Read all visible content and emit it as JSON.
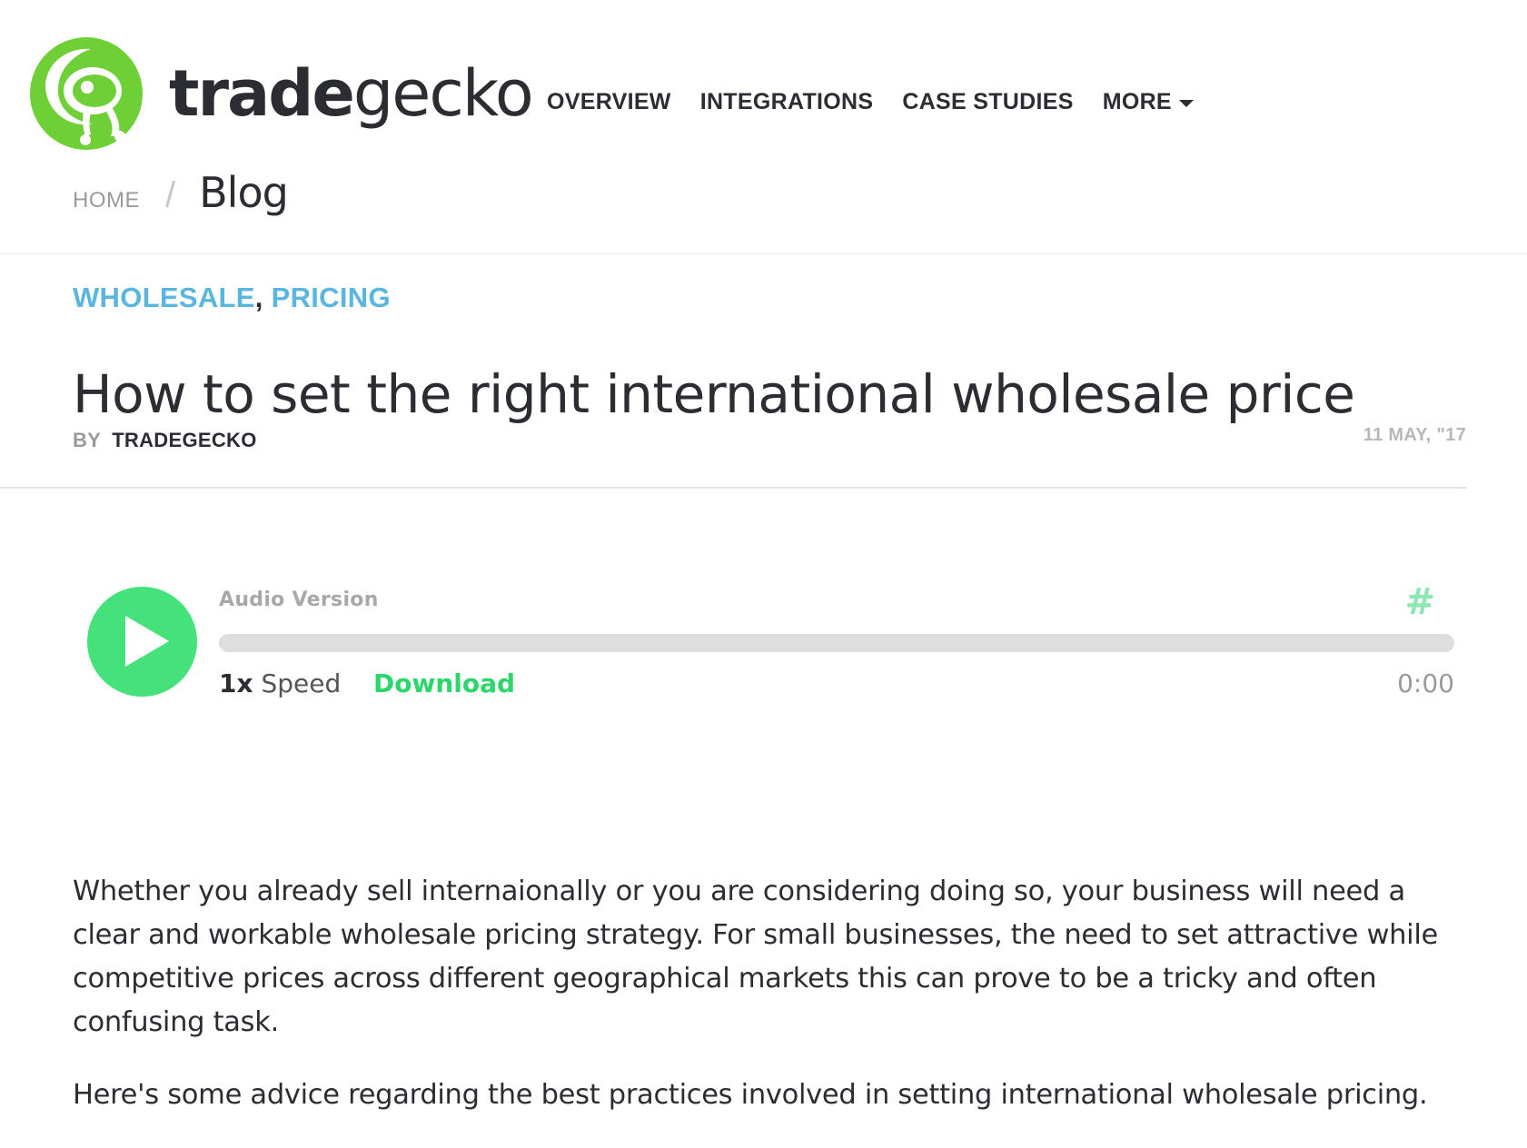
{
  "brand": {
    "name_bold": "trade",
    "name_light": "gecko",
    "logo_icon": "gecko-logo-icon",
    "accent": "#6fcf37"
  },
  "nav": {
    "items": [
      {
        "label": "OVERVIEW"
      },
      {
        "label": "INTEGRATIONS"
      },
      {
        "label": "CASE STUDIES"
      },
      {
        "label": "MORE"
      }
    ]
  },
  "breadcrumb": {
    "home": "HOME",
    "separator": "/",
    "current": "Blog"
  },
  "article": {
    "categories": [
      "WHOLESALE",
      "PRICING"
    ],
    "category_separator": ",",
    "category_color": "#5ab6de",
    "title": "How to set the right international wholesale price",
    "by_label": "BY",
    "author": "TRADEGECKO",
    "date": "11 MAY, \"17",
    "paragraphs": [
      "Whether you already sell internaionally or you are considering doing so, your business will need a clear and workable wholesale pricing strategy. For small businesses, the need to set attractive while competitive prices across different geographical markets this can prove to be a tricky and often confusing task.",
      "Here's some advice regarding the best practices involved in setting international wholesale pricing."
    ]
  },
  "audio": {
    "label": "Audio Version",
    "hash": "#",
    "speed_value": "1x",
    "speed_label": "Speed",
    "download": "Download",
    "time": "0:00",
    "progress": 0,
    "accent": "#45e27c"
  }
}
